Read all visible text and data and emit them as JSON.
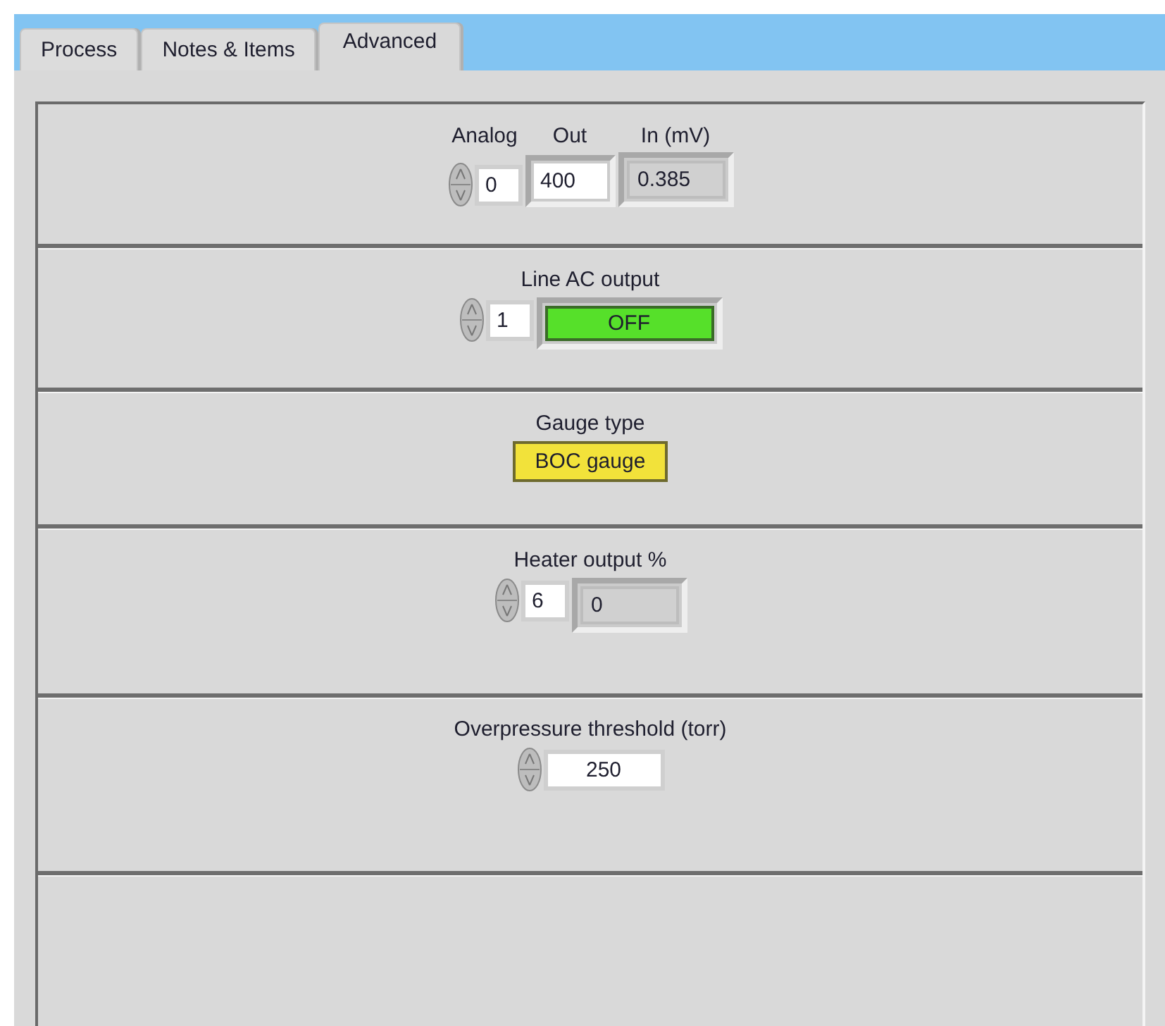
{
  "tabs": [
    {
      "label": "Process",
      "selected": false
    },
    {
      "label": "Notes & Items",
      "selected": false
    },
    {
      "label": "Advanced",
      "selected": true
    }
  ],
  "sections": [
    {
      "controls": [
        {
          "kind": "numeric",
          "label": "Analog",
          "value": "0"
        },
        {
          "kind": "entry",
          "label": "Out",
          "value": "400"
        },
        {
          "kind": "indicator",
          "label": "In (mV)",
          "value": "0.385"
        }
      ]
    },
    {
      "title": "Line AC output",
      "controls": [
        {
          "kind": "numeric",
          "value": "1"
        },
        {
          "kind": "button",
          "value": "OFF"
        }
      ]
    },
    {
      "title": "Gauge type",
      "controls": [
        {
          "kind": "ring",
          "value": "BOC gauge"
        }
      ]
    },
    {
      "title": "Heater output %",
      "controls": [
        {
          "kind": "numeric",
          "value": "6"
        },
        {
          "kind": "indicator",
          "value": "0"
        }
      ]
    },
    {
      "title": "Overpressure threshold (torr)",
      "controls": [
        {
          "kind": "numeric",
          "value": "250",
          "wide": true
        }
      ]
    }
  ]
}
